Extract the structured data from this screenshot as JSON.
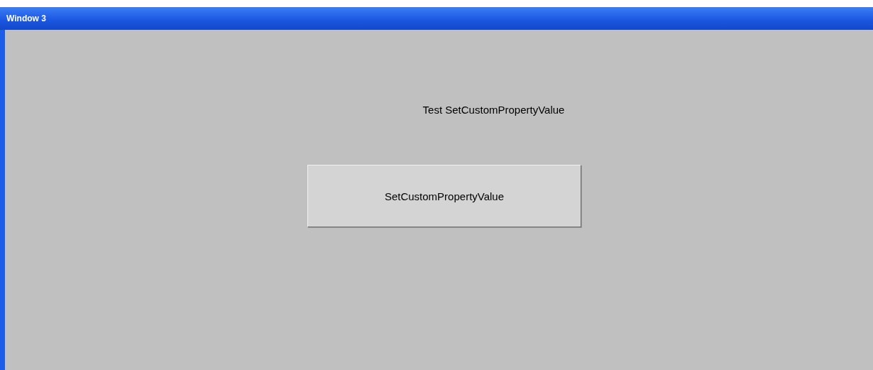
{
  "window": {
    "title": "Window 3"
  },
  "label": "Test SetCustomPropertyValue",
  "button": {
    "label": "SetCustomPropertyValue"
  }
}
